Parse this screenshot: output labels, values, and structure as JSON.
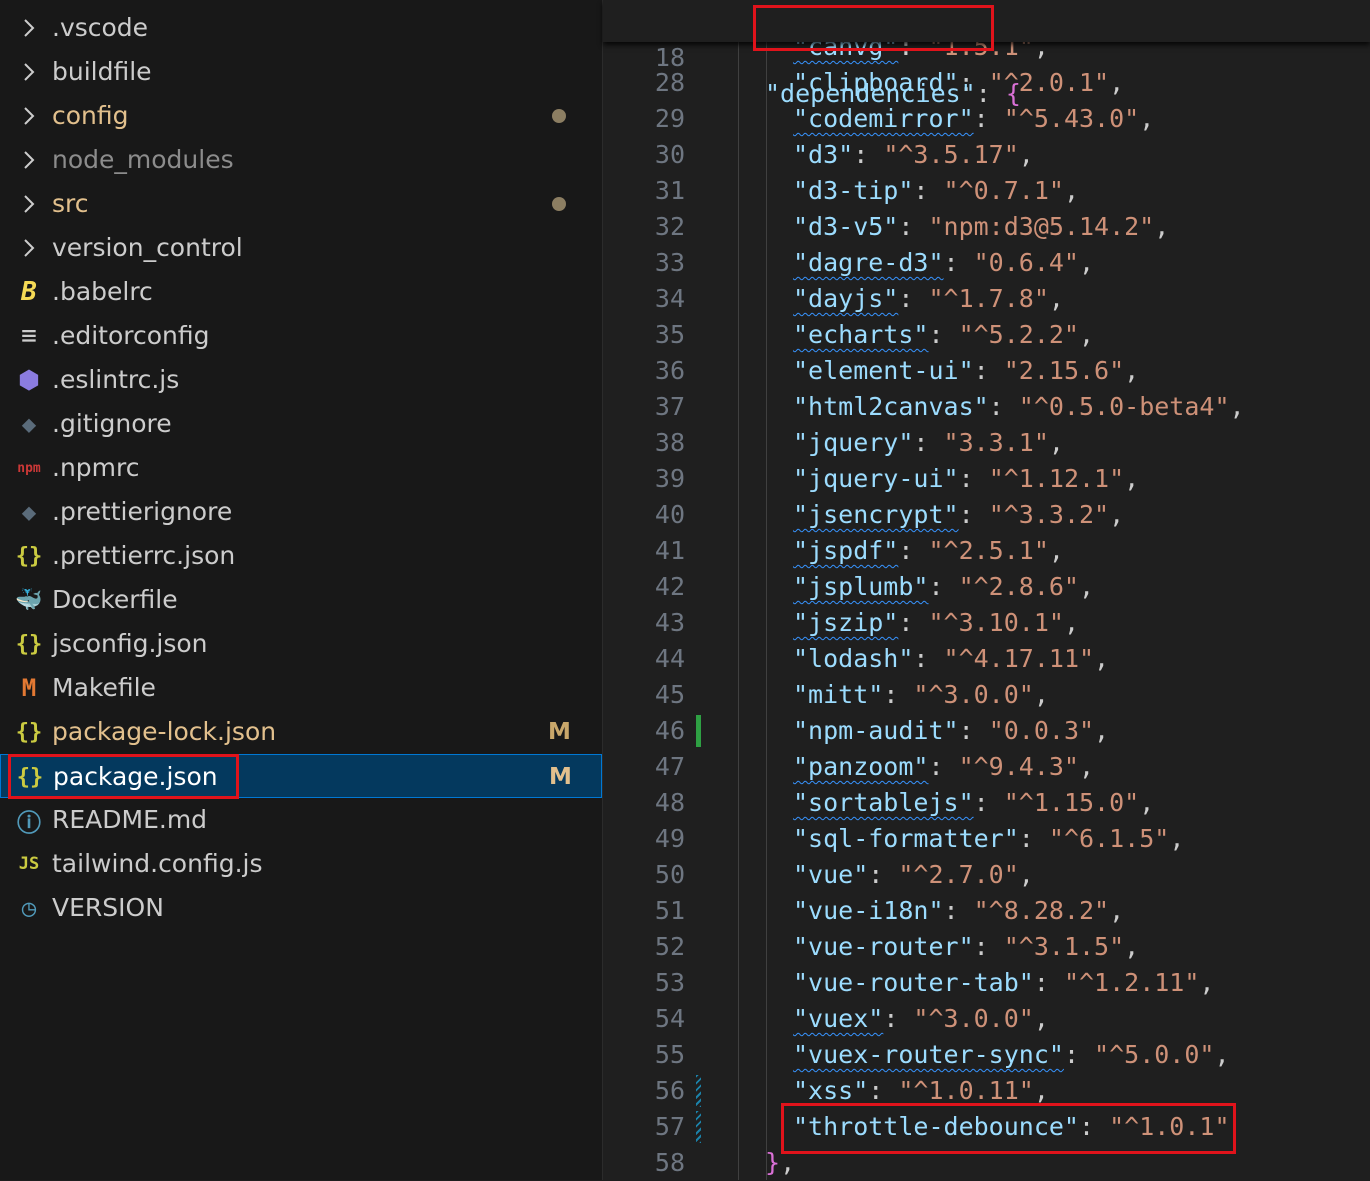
{
  "explorer": {
    "items": [
      {
        "label": ".vscode",
        "type": "folder",
        "icon": "chevron-right-icon",
        "color": "#cccccc"
      },
      {
        "label": "buildfile",
        "type": "folder",
        "icon": "chevron-right-icon",
        "color": "#cccccc"
      },
      {
        "label": "config",
        "type": "folder",
        "icon": "chevron-right-icon",
        "color": "#e2c08d",
        "modified_dot": true
      },
      {
        "label": "node_modules",
        "type": "folder",
        "icon": "chevron-right-icon",
        "color": "#8c8c8c"
      },
      {
        "label": "src",
        "type": "folder",
        "icon": "chevron-right-icon",
        "color": "#e2c08d",
        "modified_dot": true
      },
      {
        "label": "version_control",
        "type": "folder",
        "icon": "chevron-right-icon",
        "color": "#cccccc"
      },
      {
        "label": ".babelrc",
        "type": "file",
        "icon": "babel-icon",
        "glyph": "B",
        "icon_color": "#f5da55",
        "color": "#cccccc"
      },
      {
        "label": ".editorconfig",
        "type": "file",
        "icon": "lines-icon",
        "glyph": "≡",
        "icon_color": "#cccccc",
        "color": "#cccccc"
      },
      {
        "label": ".eslintrc.js",
        "type": "file",
        "icon": "eslint-icon",
        "glyph": "⬢",
        "icon_color": "#8b7ce0",
        "color": "#cccccc"
      },
      {
        "label": ".gitignore",
        "type": "file",
        "icon": "git-icon",
        "glyph": "◆",
        "icon_color": "#5a6b7a",
        "color": "#cccccc"
      },
      {
        "label": ".npmrc",
        "type": "file",
        "icon": "npm-icon",
        "glyph": "npm",
        "icon_color": "#cb3837",
        "color": "#cccccc"
      },
      {
        "label": ".prettierignore",
        "type": "file",
        "icon": "git-icon",
        "glyph": "◆",
        "icon_color": "#5a6b7a",
        "color": "#cccccc"
      },
      {
        "label": ".prettierrc.json",
        "type": "file",
        "icon": "json-braces-icon",
        "glyph": "{}",
        "icon_color": "#cbcb41",
        "color": "#cccccc"
      },
      {
        "label": "Dockerfile",
        "type": "file",
        "icon": "docker-icon",
        "glyph": "🐳",
        "icon_color": "#4a8ec2",
        "color": "#cccccc"
      },
      {
        "label": "jsconfig.json",
        "type": "file",
        "icon": "json-braces-icon",
        "glyph": "{}",
        "icon_color": "#cbcb41",
        "color": "#cccccc"
      },
      {
        "label": "Makefile",
        "type": "file",
        "icon": "makefile-icon",
        "glyph": "M",
        "icon_color": "#e37933",
        "color": "#cccccc"
      },
      {
        "label": "package-lock.json",
        "type": "file",
        "icon": "json-braces-icon",
        "glyph": "{}",
        "icon_color": "#cbcb41",
        "color": "#e2c08d",
        "git_status": "M"
      },
      {
        "label": "package.json",
        "type": "file",
        "icon": "json-braces-icon",
        "glyph": "{}",
        "icon_color": "#cbcb41",
        "color": "#ffffff",
        "git_status": "M",
        "selected": true
      },
      {
        "label": "README.md",
        "type": "file",
        "icon": "info-icon",
        "glyph": "ⓘ",
        "icon_color": "#519aba",
        "color": "#cccccc"
      },
      {
        "label": "tailwind.config.js",
        "type": "file",
        "icon": "js-icon",
        "glyph": "JS",
        "icon_color": "#cbcb41",
        "color": "#cccccc"
      },
      {
        "label": "VERSION",
        "type": "file",
        "icon": "clock-icon",
        "glyph": "◷",
        "icon_color": "#519aba",
        "color": "#cccccc"
      }
    ]
  },
  "editor": {
    "sticky_header": {
      "line": "18",
      "key": "\"dependencies\"",
      "punct": ": ",
      "brace": "{"
    },
    "partial_line": {
      "key": "\"canvg\"",
      "value": "\"1.5.1\"",
      "punct": ","
    },
    "lines": [
      {
        "n": "28",
        "key": "\"clipboard\"",
        "value": "\"^2.0.1\"",
        "squiggle": false
      },
      {
        "n": "29",
        "key": "\"codemirror\"",
        "value": "\"^5.43.0\"",
        "squiggle": true
      },
      {
        "n": "30",
        "key": "\"d3\"",
        "value": "\"^3.5.17\"",
        "squiggle": false
      },
      {
        "n": "31",
        "key": "\"d3-tip\"",
        "value": "\"^0.7.1\"",
        "squiggle": false
      },
      {
        "n": "32",
        "key": "\"d3-v5\"",
        "value": "\"npm:d3@5.14.2\"",
        "squiggle": false
      },
      {
        "n": "33",
        "key": "\"dagre-d3\"",
        "value": "\"0.6.4\"",
        "squiggle": true
      },
      {
        "n": "34",
        "key": "\"dayjs\"",
        "value": "\"^1.7.8\"",
        "squiggle": true
      },
      {
        "n": "35",
        "key": "\"echarts\"",
        "value": "\"^5.2.2\"",
        "squiggle": true
      },
      {
        "n": "36",
        "key": "\"element-ui\"",
        "value": "\"2.15.6\"",
        "squiggle": false
      },
      {
        "n": "37",
        "key": "\"html2canvas\"",
        "value": "\"^0.5.0-beta4\"",
        "squiggle": false
      },
      {
        "n": "38",
        "key": "\"jquery\"",
        "value": "\"3.3.1\"",
        "squiggle": false
      },
      {
        "n": "39",
        "key": "\"jquery-ui\"",
        "value": "\"^1.12.1\"",
        "squiggle": false
      },
      {
        "n": "40",
        "key": "\"jsencrypt\"",
        "value": "\"^3.3.2\"",
        "squiggle": true
      },
      {
        "n": "41",
        "key": "\"jspdf\"",
        "value": "\"^2.5.1\"",
        "squiggle": true
      },
      {
        "n": "42",
        "key": "\"jsplumb\"",
        "value": "\"^2.8.6\"",
        "squiggle": true
      },
      {
        "n": "43",
        "key": "\"jszip\"",
        "value": "\"^3.10.1\"",
        "squiggle": true
      },
      {
        "n": "44",
        "key": "\"lodash\"",
        "value": "\"^4.17.11\"",
        "squiggle": false
      },
      {
        "n": "45",
        "key": "\"mitt\"",
        "value": "\"^3.0.0\"",
        "squiggle": false
      },
      {
        "n": "46",
        "key": "\"npm-audit\"",
        "value": "\"0.0.3\"",
        "squiggle": false,
        "gutter": "added"
      },
      {
        "n": "47",
        "key": "\"panzoom\"",
        "value": "\"^9.4.3\"",
        "squiggle": true
      },
      {
        "n": "48",
        "key": "\"sortablejs\"",
        "value": "\"^1.15.0\"",
        "squiggle": true
      },
      {
        "n": "49",
        "key": "\"sql-formatter\"",
        "value": "\"^6.1.5\"",
        "squiggle": false
      },
      {
        "n": "50",
        "key": "\"vue\"",
        "value": "\"^2.7.0\"",
        "squiggle": false
      },
      {
        "n": "51",
        "key": "\"vue-i18n\"",
        "value": "\"^8.28.2\"",
        "squiggle": false
      },
      {
        "n": "52",
        "key": "\"vue-router\"",
        "value": "\"^3.1.5\"",
        "squiggle": false
      },
      {
        "n": "53",
        "key": "\"vue-router-tab\"",
        "value": "\"^1.2.11\"",
        "squiggle": false
      },
      {
        "n": "54",
        "key": "\"vuex\"",
        "value": "\"^3.0.0\"",
        "squiggle": true
      },
      {
        "n": "55",
        "key": "\"vuex-router-sync\"",
        "value": "\"^5.0.0\"",
        "squiggle": true
      },
      {
        "n": "56",
        "key": "\"xss\"",
        "value": "\"^1.0.11\"",
        "squiggle": false,
        "gutter": "modified"
      },
      {
        "n": "57",
        "key": "\"throttle-debounce\"",
        "value": "\"^1.0.1\"",
        "squiggle": false,
        "gutter": "modified",
        "no_comma": true
      }
    ],
    "closing": {
      "n": "58",
      "brace": "}",
      "punct": ","
    }
  },
  "colors": {
    "key": "#9cdcfe",
    "string": "#ce9178",
    "highlight_box": "#e0131b",
    "selection_bg": "#04395e",
    "git_added": "#2ea043",
    "git_modified": "#1b81a8"
  }
}
